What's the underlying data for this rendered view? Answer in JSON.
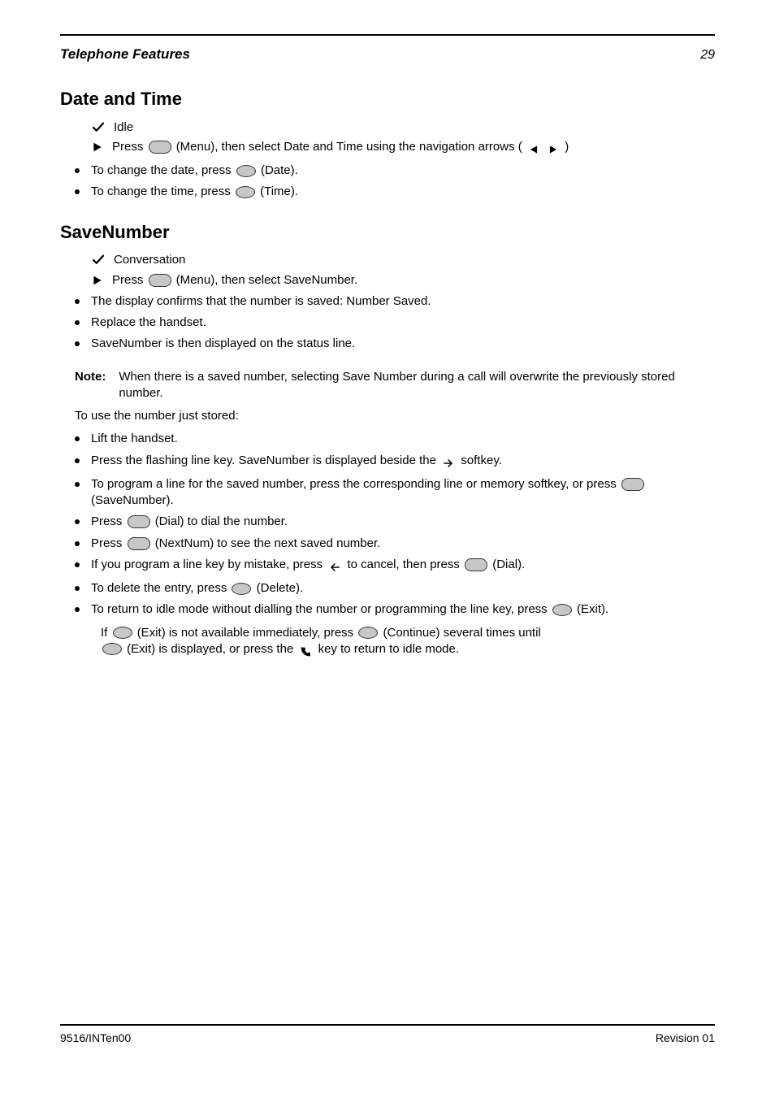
{
  "header": {
    "title": "Telephone Features",
    "page": "29"
  },
  "sections": [
    {
      "title": "Date and Time",
      "check_items": [
        "Idle"
      ],
      "play_items": [
        {
          "pre": "Press ",
          "post": " (Menu), then select Date and Time using the navigation arrows (",
          "tail": ")"
        }
      ],
      "bullets": [
        {
          "pre": "To change the date, press ",
          "post": " (Date).",
          "round": true
        },
        {
          "pre": "To change the time, press ",
          "post": " (Time).",
          "round": true
        }
      ]
    },
    {
      "title": "SaveNumber",
      "check_items": [
        "Conversation"
      ],
      "play_items": [
        {
          "pre": "Press ",
          "post": " (Menu), then select SaveNumber.",
          "tail": ""
        }
      ],
      "bullets": [
        {
          "text": "The display confirms that the number is saved: Number Saved."
        },
        {
          "text": "Replace the handset."
        },
        {
          "text": "SaveNumber is then displayed on the status line."
        }
      ],
      "note": {
        "label": "Note:",
        "body": "When there is a saved number, selecting Save Number during a call will overwrite the previously stored number."
      },
      "para_intro": "To use the number just stored:",
      "use_bullets": [
        {
          "text": "Lift the handset."
        },
        {
          "pre": "Press the flashing line key. SaveNumber is displayed beside the  ",
          "post_icon": "arrow-right",
          "post": "  softkey."
        },
        {
          "pre": "To program a line for the saved number, press the corresponding line or memory softkey, or press ",
          "post": " (SaveNumber)."
        },
        {
          "pre": "Press ",
          "post": " (Dial) to dial the number."
        },
        {
          "pre": "Press ",
          "post": " (NextNum) to see the next saved number."
        },
        {
          "pre": "If you program a line key by mistake, press  ",
          "mid_icon": "arrow-left",
          "mid": "  to cancel, then press ",
          "post": " (Dial)."
        },
        {
          "pre": "To delete the entry, press ",
          "post": " (Delete).",
          "round": true
        },
        {
          "pre": "To return to idle mode without dialling the number or programming the line key, press ",
          "post": " (Exit).",
          "round": true
        }
      ],
      "trailing": {
        "pre": "If ",
        "mid": " (Exit) is not available immediately, press ",
        "post": " (Continue) several times until",
        "last_pre": "",
        "last_mid": " (Exit) is displayed, or press the  ",
        "phone_post": "  key to return to idle mode."
      }
    }
  ],
  "footer": {
    "left": "9516/INTen00",
    "right": "Revision 01"
  }
}
